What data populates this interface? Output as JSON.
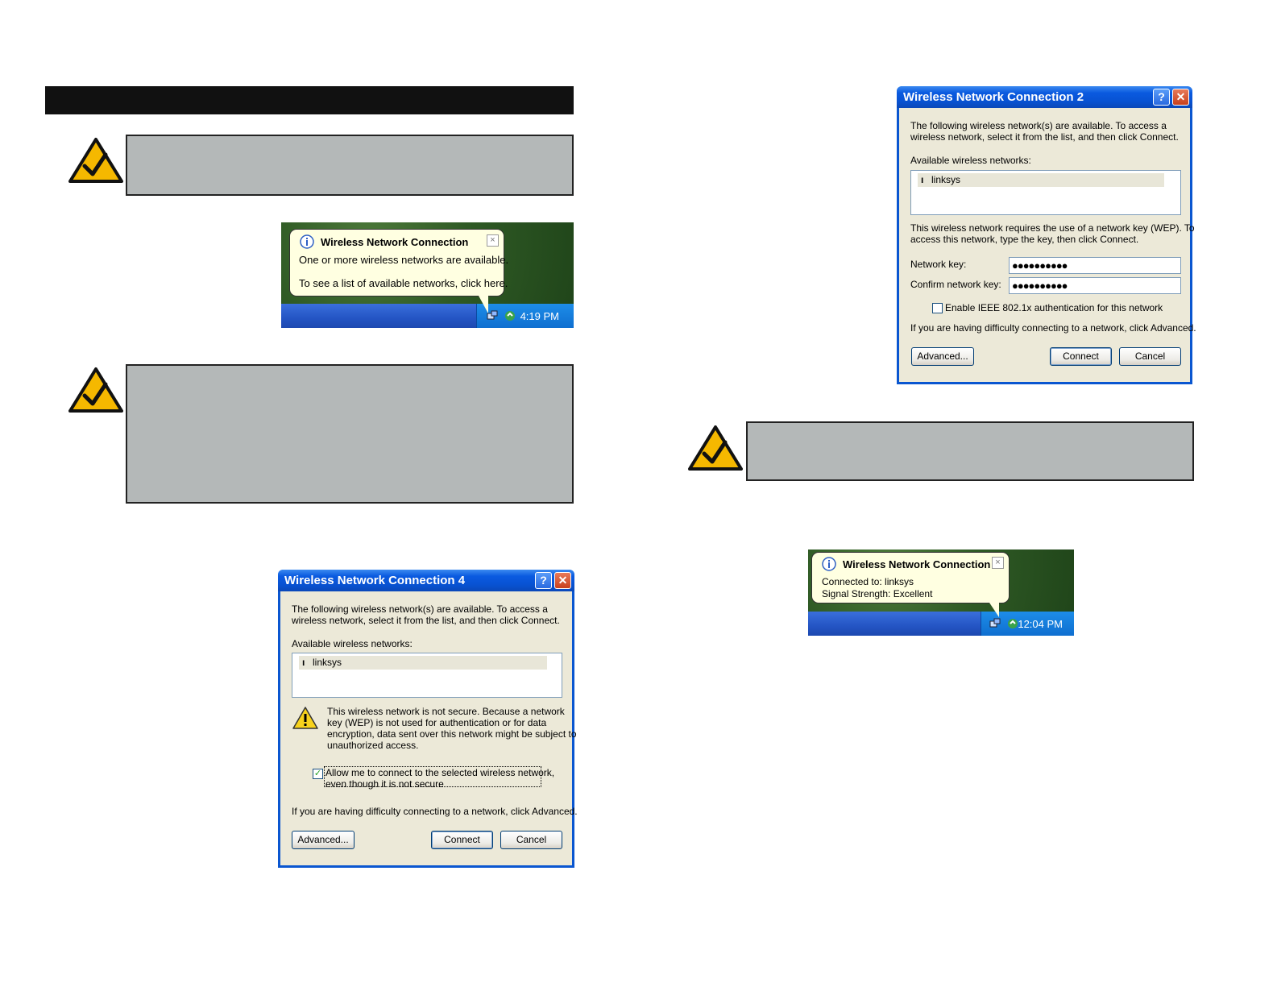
{
  "balloon1": {
    "title": "Wireless Network Connection",
    "line1": "One or more wireless networks are available.",
    "line2": "To see a list of available networks, click here.",
    "close": "×",
    "time": "4:19 PM"
  },
  "dialog4": {
    "title": "Wireless Network Connection 4",
    "help": "?",
    "close": "✕",
    "intro1": "The following wireless network(s) are available. To access a",
    "intro2": "wireless network, select it from the list, and then click Connect.",
    "available_label": "Available wireless networks:",
    "network": "linksys",
    "warn1": "This wireless network is not secure. Because a network",
    "warn2": "key (WEP) is not used for authentication or for data",
    "warn3": "encryption, data sent over this network might be subject to",
    "warn4": "unauthorized access.",
    "allow1": "Allow me to connect to the selected wireless network,",
    "allow2": "even though it is not secure",
    "allow_checked": "✓",
    "difficulty": "If you are having difficulty connecting to a network, click Advanced.",
    "advanced": "Advanced...",
    "connect": "Connect",
    "cancel": "Cancel"
  },
  "dialog2": {
    "title": "Wireless Network Connection 2",
    "help": "?",
    "close": "✕",
    "intro1": "The following wireless network(s) are available. To access a",
    "intro2": "wireless network, select it from the list, and then click Connect.",
    "available_label": "Available wireless networks:",
    "network": "linksys",
    "wep1": "This wireless network requires the use of a network key (WEP). To",
    "wep2": "access this network, type the key, then click Connect.",
    "network_key_label": "Network key:",
    "network_key_value": "●●●●●●●●●●",
    "confirm_key_label": "Confirm network key:",
    "confirm_key_value": "●●●●●●●●●●",
    "ieee_label": "Enable IEEE 802.1x authentication for this network",
    "difficulty": "If you are having difficulty connecting to a network, click Advanced.",
    "advanced": "Advanced...",
    "connect": "Connect",
    "cancel": "Cancel"
  },
  "balloon2": {
    "title": "Wireless Network Connection",
    "line1": "Connected to: linksys",
    "line2": "Signal Strength: Excellent",
    "close": "×",
    "time": "12:04 PM"
  }
}
